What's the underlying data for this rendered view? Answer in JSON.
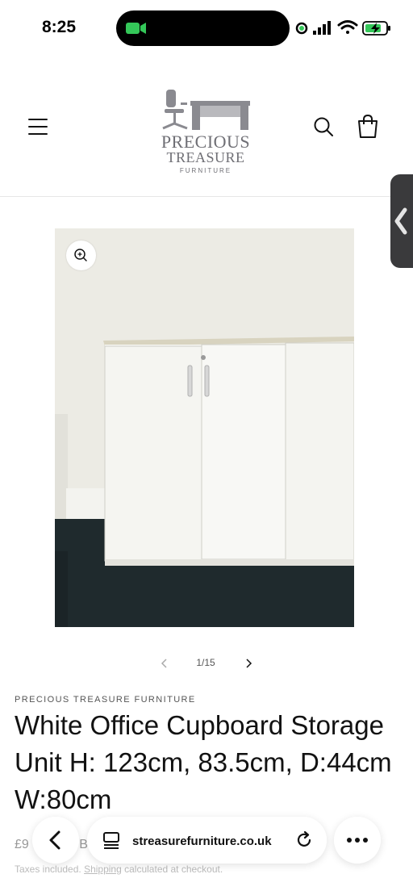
{
  "status_bar": {
    "time": "8:25"
  },
  "header": {
    "logo": {
      "line1": "PRECIOUS",
      "line2": "TREASURE",
      "line3": "FURNITURE"
    },
    "icons": [
      "hamburger-menu-icon",
      "search-icon",
      "cart-icon"
    ]
  },
  "media": {
    "counter": "1/15",
    "zoom_icon": "zoom-in-icon"
  },
  "product": {
    "vendor": "PRECIOUS TREASURE FURNITURE",
    "title": "White Office Cupboard Storage Unit H: 123cm, 83.5cm, D:44cm W:80cm",
    "price_partial": "£9",
    "price_partial_2": "B",
    "tax_prefix": "Taxes included.",
    "tax_link": "Shipping",
    "tax_suffix": "calculated at checkout."
  },
  "browser": {
    "url": "streasurefurniture.co.uk"
  },
  "colors": {
    "logo_grey": "#6f6f75",
    "tab_dark": "#3a3a3c",
    "facetime_green": "#34c759"
  }
}
